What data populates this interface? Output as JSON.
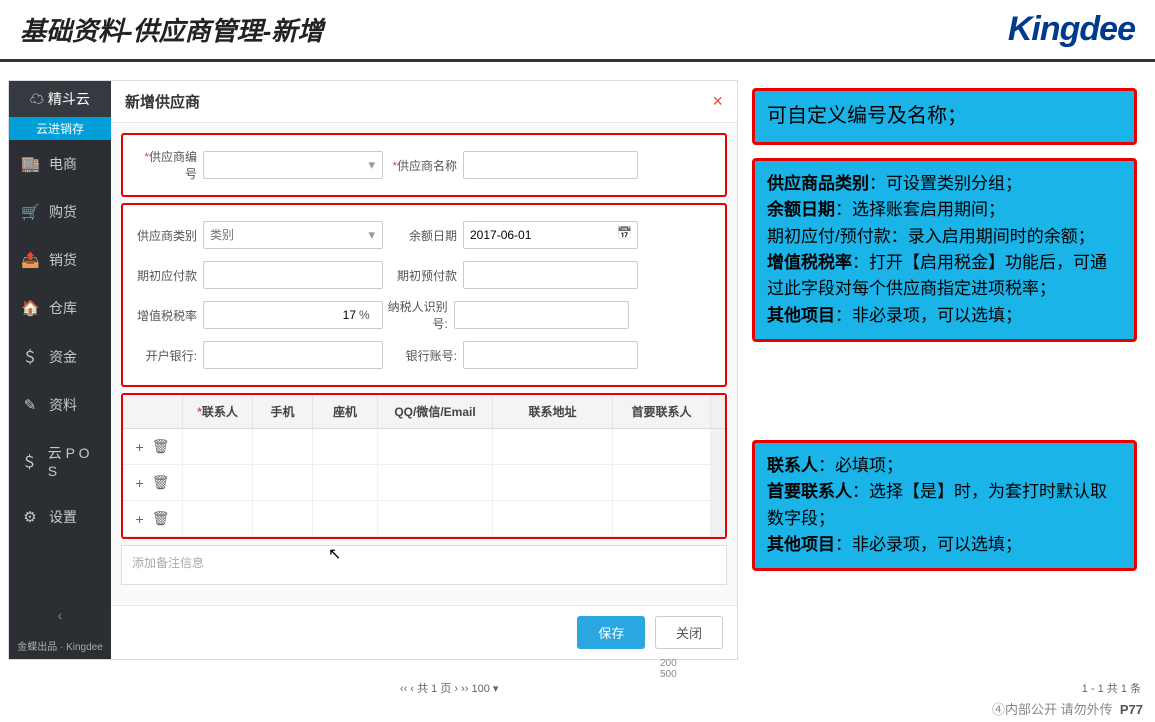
{
  "slide": {
    "title": "基础资料-供应商管理-新增",
    "logo": "Kingdee",
    "footer": "④内部公开 请勿外传",
    "page_no": "P77"
  },
  "sidebar": {
    "top_logo": "☁ 精斗云",
    "active_tab": "云进销存",
    "items": [
      {
        "icon": "🏬",
        "label": "电商"
      },
      {
        "icon": "🛒",
        "label": "购货"
      },
      {
        "icon": "📤",
        "label": "销货"
      },
      {
        "icon": "🏠",
        "label": "仓库"
      },
      {
        "icon": "＄",
        "label": "资金"
      },
      {
        "icon": "✎",
        "label": "资料"
      },
      {
        "icon": "＄",
        "label": "云 P O S"
      },
      {
        "icon": "⚙",
        "label": "设置"
      }
    ],
    "collapse": "‹",
    "footer_brand": "金蝶出品 · Kingdee"
  },
  "modal": {
    "title": "新增供应商",
    "close": "×",
    "sec1": {
      "number_label": "供应商编号",
      "name_label": "供应商名称"
    },
    "sec2": {
      "category_label": "供应商类别",
      "category_placeholder": "类别",
      "balance_date_label": "余额日期",
      "balance_date_value": "2017-06-01",
      "init_payable_label": "期初应付款",
      "init_prepaid_label": "期初预付款",
      "vat_rate_label": "增值税税率",
      "vat_rate_value": "17",
      "vat_unit": "%",
      "taxpayer_id_label": "纳税人识别号:",
      "bank_label": "开户银行:",
      "account_label": "银行账号:"
    },
    "contacts": {
      "headers": [
        "联系人",
        "手机",
        "座机",
        "QQ/微信/Email",
        "联系地址",
        "首要联系人"
      ],
      "add": "+",
      "del": "🗑"
    },
    "memo_placeholder": "添加备注信息",
    "save": "保存",
    "close_btn": "关闭"
  },
  "callouts": {
    "a": "可自定义编号及名称；",
    "b": {
      "l1a": "供应商品类别",
      "l1b": "：可设置类别分组；",
      "l2a": "余额日期",
      "l2b": "：选择账套启用期间；",
      "l3": "期初应付/预付款：录入启用期间时的余额；",
      "l4a": "增值税税率",
      "l4b": "：打开【启用税金】功能后，可通过此字段对每个供应商指定进项税率；",
      "l5a": "其他项目",
      "l5b": "：非必录项，可以选填；"
    },
    "c": {
      "l1a": "联系人",
      "l1b": "：必填项；",
      "l2a": "首要联系人",
      "l2b": "：选择【是】时，为套打时默认取数字段；",
      "l3a": "其他项目",
      "l3b": "：非必录项，可以选填；"
    }
  },
  "pager": {
    "nav": "‹‹ ‹ 共 1 页 › ›› 100 ▾",
    "info": "1 - 1  共 1 条",
    "rulers": "200\n500"
  }
}
